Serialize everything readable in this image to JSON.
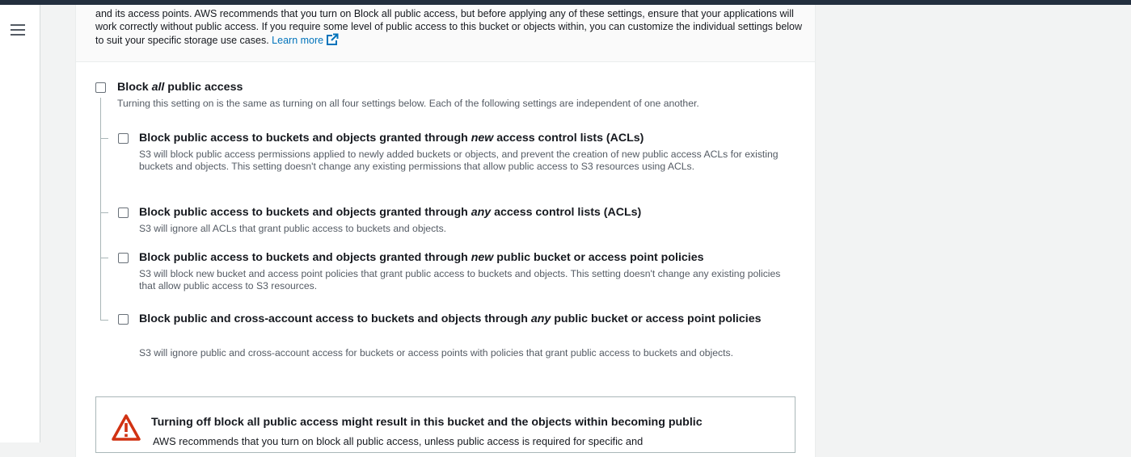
{
  "nav": {
    "menu_icon": "hamburger-menu-icon"
  },
  "intro": {
    "text": "and its access points. AWS recommends that you turn on Block all public access, but before applying any of these settings, ensure that your applications will work correctly without public access. If you require some level of public access to this bucket or objects within, you can customize the individual settings below to suit your specific storage use cases.",
    "learn_more": "Learn more",
    "external_icon": "external-link-icon"
  },
  "block_all": {
    "title_pre": "Block ",
    "title_em": "all",
    "title_post": " public access",
    "description": "Turning this setting on is the same as turning on all four settings below. Each of the following settings are independent of one another.",
    "checked": false
  },
  "settings": [
    {
      "title_pre": "Block public access to buckets and objects granted through ",
      "title_em": "new",
      "title_post": " access control lists (ACLs)",
      "description": "S3 will block public access permissions applied to newly added buckets or objects, and prevent the creation of new public access ACLs for existing buckets and objects. This setting doesn't change any existing permissions that allow public access to S3 resources using ACLs.",
      "checked": false
    },
    {
      "title_pre": "Block public access to buckets and objects granted through ",
      "title_em": "any",
      "title_post": " access control lists (ACLs)",
      "description": "S3 will ignore all ACLs that grant public access to buckets and objects.",
      "checked": false
    },
    {
      "title_pre": "Block public access to buckets and objects granted through ",
      "title_em": "new",
      "title_post": " public bucket or access point policies",
      "description": "S3 will block new bucket and access point policies that grant public access to buckets and objects. This setting doesn't change any existing policies that allow public access to S3 resources.",
      "checked": false
    },
    {
      "title_pre": "Block public and cross-account access to buckets and objects through ",
      "title_em": "any",
      "title_post": " public bucket or access point policies",
      "description": "S3 will ignore public and cross-account access for buckets or access points with policies that grant public access to buckets and objects.",
      "checked": false
    }
  ],
  "warning": {
    "icon": "warning-triangle-icon",
    "title": "Turning off block all public access might result in this bucket and the objects within becoming public",
    "description": "AWS recommends that you turn on block all public access, unless public access is required for specific and"
  },
  "colors": {
    "link": "#0073bb",
    "warning": "#d13212",
    "nav_dark": "#232f3e"
  }
}
